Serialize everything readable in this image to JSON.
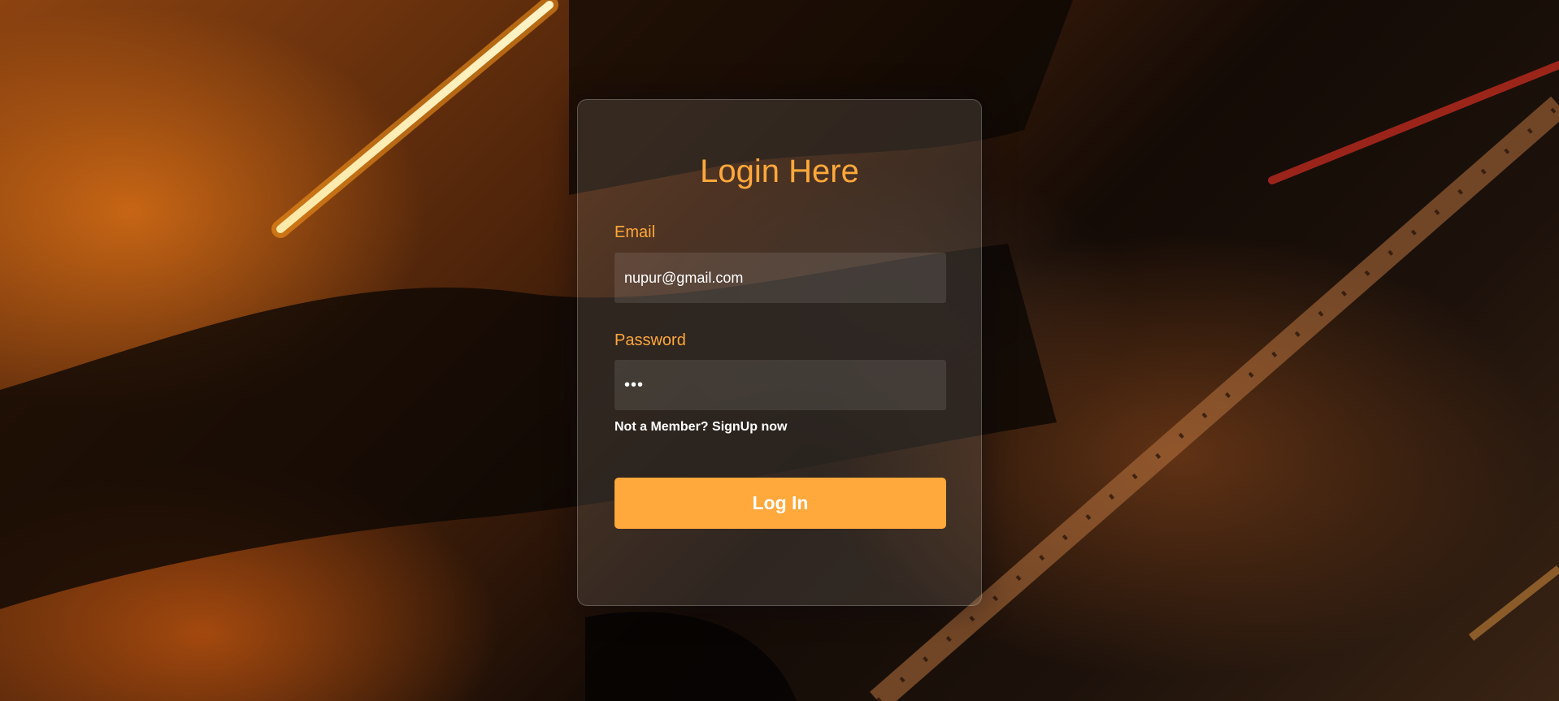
{
  "form": {
    "title": "Login Here",
    "email_label": "Email",
    "email_value": "nupur@gmail.com",
    "password_label": "Password",
    "password_value": "•••",
    "signup_text": "Not a Member? SignUp now",
    "submit_label": "Log In"
  },
  "colors": {
    "accent": "#ffa83b",
    "text_light": "#ffffff"
  }
}
